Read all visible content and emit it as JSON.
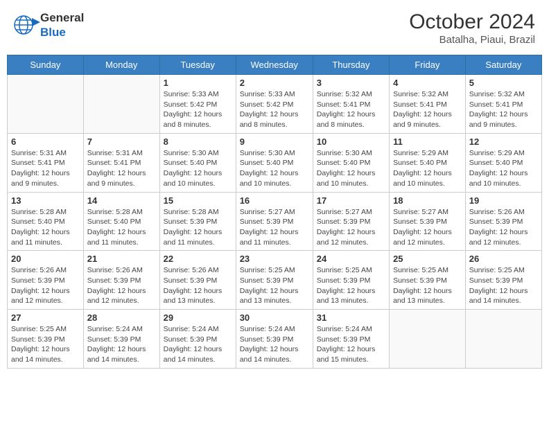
{
  "header": {
    "logo_general": "General",
    "logo_blue": "Blue",
    "month_year": "October 2024",
    "location": "Batalha, Piaui, Brazil"
  },
  "weekdays": [
    "Sunday",
    "Monday",
    "Tuesday",
    "Wednesday",
    "Thursday",
    "Friday",
    "Saturday"
  ],
  "weeks": [
    [
      {
        "day": "",
        "info": ""
      },
      {
        "day": "",
        "info": ""
      },
      {
        "day": "1",
        "info": "Sunrise: 5:33 AM\nSunset: 5:42 PM\nDaylight: 12 hours and 8 minutes."
      },
      {
        "day": "2",
        "info": "Sunrise: 5:33 AM\nSunset: 5:42 PM\nDaylight: 12 hours and 8 minutes."
      },
      {
        "day": "3",
        "info": "Sunrise: 5:32 AM\nSunset: 5:41 PM\nDaylight: 12 hours and 8 minutes."
      },
      {
        "day": "4",
        "info": "Sunrise: 5:32 AM\nSunset: 5:41 PM\nDaylight: 12 hours and 9 minutes."
      },
      {
        "day": "5",
        "info": "Sunrise: 5:32 AM\nSunset: 5:41 PM\nDaylight: 12 hours and 9 minutes."
      }
    ],
    [
      {
        "day": "6",
        "info": "Sunrise: 5:31 AM\nSunset: 5:41 PM\nDaylight: 12 hours and 9 minutes."
      },
      {
        "day": "7",
        "info": "Sunrise: 5:31 AM\nSunset: 5:41 PM\nDaylight: 12 hours and 9 minutes."
      },
      {
        "day": "8",
        "info": "Sunrise: 5:30 AM\nSunset: 5:40 PM\nDaylight: 12 hours and 10 minutes."
      },
      {
        "day": "9",
        "info": "Sunrise: 5:30 AM\nSunset: 5:40 PM\nDaylight: 12 hours and 10 minutes."
      },
      {
        "day": "10",
        "info": "Sunrise: 5:30 AM\nSunset: 5:40 PM\nDaylight: 12 hours and 10 minutes."
      },
      {
        "day": "11",
        "info": "Sunrise: 5:29 AM\nSunset: 5:40 PM\nDaylight: 12 hours and 10 minutes."
      },
      {
        "day": "12",
        "info": "Sunrise: 5:29 AM\nSunset: 5:40 PM\nDaylight: 12 hours and 10 minutes."
      }
    ],
    [
      {
        "day": "13",
        "info": "Sunrise: 5:28 AM\nSunset: 5:40 PM\nDaylight: 12 hours and 11 minutes."
      },
      {
        "day": "14",
        "info": "Sunrise: 5:28 AM\nSunset: 5:40 PM\nDaylight: 12 hours and 11 minutes."
      },
      {
        "day": "15",
        "info": "Sunrise: 5:28 AM\nSunset: 5:39 PM\nDaylight: 12 hours and 11 minutes."
      },
      {
        "day": "16",
        "info": "Sunrise: 5:27 AM\nSunset: 5:39 PM\nDaylight: 12 hours and 11 minutes."
      },
      {
        "day": "17",
        "info": "Sunrise: 5:27 AM\nSunset: 5:39 PM\nDaylight: 12 hours and 12 minutes."
      },
      {
        "day": "18",
        "info": "Sunrise: 5:27 AM\nSunset: 5:39 PM\nDaylight: 12 hours and 12 minutes."
      },
      {
        "day": "19",
        "info": "Sunrise: 5:26 AM\nSunset: 5:39 PM\nDaylight: 12 hours and 12 minutes."
      }
    ],
    [
      {
        "day": "20",
        "info": "Sunrise: 5:26 AM\nSunset: 5:39 PM\nDaylight: 12 hours and 12 minutes."
      },
      {
        "day": "21",
        "info": "Sunrise: 5:26 AM\nSunset: 5:39 PM\nDaylight: 12 hours and 12 minutes."
      },
      {
        "day": "22",
        "info": "Sunrise: 5:26 AM\nSunset: 5:39 PM\nDaylight: 12 hours and 13 minutes."
      },
      {
        "day": "23",
        "info": "Sunrise: 5:25 AM\nSunset: 5:39 PM\nDaylight: 12 hours and 13 minutes."
      },
      {
        "day": "24",
        "info": "Sunrise: 5:25 AM\nSunset: 5:39 PM\nDaylight: 12 hours and 13 minutes."
      },
      {
        "day": "25",
        "info": "Sunrise: 5:25 AM\nSunset: 5:39 PM\nDaylight: 12 hours and 13 minutes."
      },
      {
        "day": "26",
        "info": "Sunrise: 5:25 AM\nSunset: 5:39 PM\nDaylight: 12 hours and 14 minutes."
      }
    ],
    [
      {
        "day": "27",
        "info": "Sunrise: 5:25 AM\nSunset: 5:39 PM\nDaylight: 12 hours and 14 minutes."
      },
      {
        "day": "28",
        "info": "Sunrise: 5:24 AM\nSunset: 5:39 PM\nDaylight: 12 hours and 14 minutes."
      },
      {
        "day": "29",
        "info": "Sunrise: 5:24 AM\nSunset: 5:39 PM\nDaylight: 12 hours and 14 minutes."
      },
      {
        "day": "30",
        "info": "Sunrise: 5:24 AM\nSunset: 5:39 PM\nDaylight: 12 hours and 14 minutes."
      },
      {
        "day": "31",
        "info": "Sunrise: 5:24 AM\nSunset: 5:39 PM\nDaylight: 12 hours and 15 minutes."
      },
      {
        "day": "",
        "info": ""
      },
      {
        "day": "",
        "info": ""
      }
    ]
  ]
}
